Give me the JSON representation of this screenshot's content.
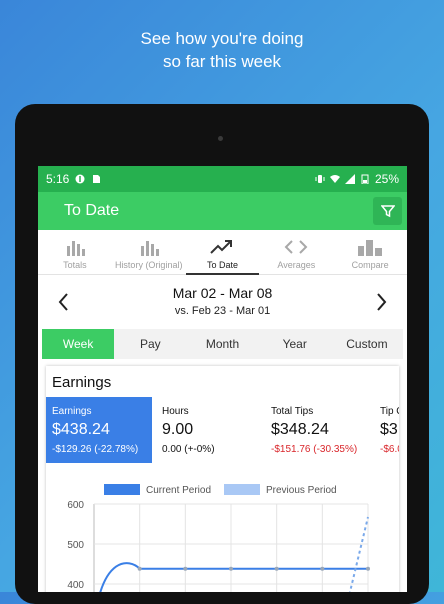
{
  "promo": {
    "line1": "See how you're doing",
    "line2": "so far this week"
  },
  "status_bar": {
    "time": "5:16",
    "battery": "25%"
  },
  "app_bar": {
    "title": "To Date",
    "filter_icon": "filter-icon"
  },
  "tabs": [
    {
      "label": "Totals",
      "icon": "bar-chart-icon",
      "active": false
    },
    {
      "label": "History (Original)",
      "icon": "bar-chart-icon",
      "active": false
    },
    {
      "label": "To Date",
      "icon": "trend-up-icon",
      "active": true
    },
    {
      "label": "Averages",
      "icon": "code-brackets-icon",
      "active": false
    },
    {
      "label": "Compare",
      "icon": "compare-bars-icon",
      "active": false
    }
  ],
  "period": {
    "main": "Mar 02 - Mar 08",
    "compare": "vs. Feb 23 - Mar 01"
  },
  "segments": [
    "Week",
    "Pay",
    "Month",
    "Year",
    "Custom"
  ],
  "earnings": {
    "title": "Earnings",
    "metrics": [
      {
        "label": "Earnings",
        "value": "$438.24",
        "change": "-$129.26 (-22.78%)",
        "selected": true,
        "negative": false
      },
      {
        "label": "Hours",
        "value": "9.00",
        "change": "0.00 (+-0%)",
        "selected": false,
        "negative": false
      },
      {
        "label": "Total Tips",
        "value": "$348.24",
        "change": "-$151.76 (-30.35%)",
        "selected": false,
        "negative": true
      },
      {
        "label": "Tip O",
        "value": "$3",
        "change": "-$6.0",
        "selected": false,
        "negative": true
      }
    ]
  },
  "colors": {
    "brand_green": "#3ccc64",
    "status_green": "#26b04f",
    "accent_blue": "#3a7fe6",
    "negative_red": "#d9262b"
  },
  "chart_data": {
    "type": "line",
    "legend": [
      "Current Period",
      "Previous Period"
    ],
    "yticks": [
      400,
      500,
      600
    ],
    "ylim": [
      340,
      600
    ],
    "grid": true,
    "series": [
      {
        "name": "Current Period",
        "style": "solid",
        "x": [
          0,
          1,
          2,
          3,
          4,
          5,
          6
        ],
        "values": [
          300,
          438.24,
          438.24,
          438.24,
          438.24,
          438.24,
          438.24
        ]
      },
      {
        "name": "Previous Period",
        "style": "dashed",
        "x": [
          5.5,
          6
        ],
        "values": [
          330,
          567.5
        ]
      }
    ]
  }
}
